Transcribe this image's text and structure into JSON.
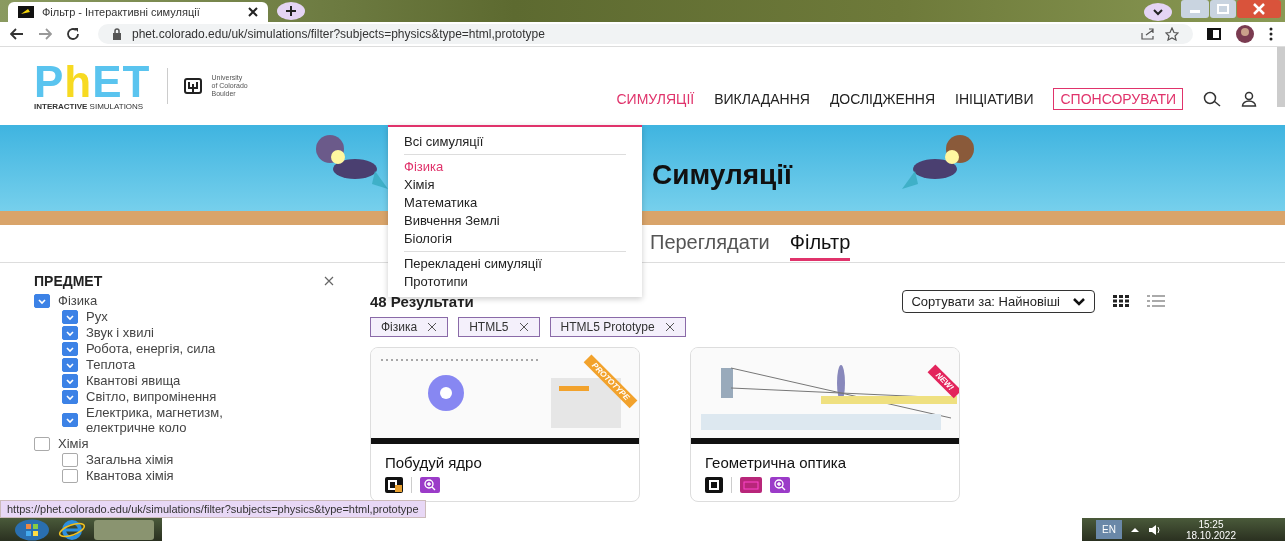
{
  "browser": {
    "tab_title": "Фільтр - Інтерактивні симуляції",
    "url": "phet.colorado.edu/uk/simulations/filter?subjects=physics&type=html,prototype"
  },
  "header": {
    "logo": {
      "wordmark": "PhET",
      "tagline_bold": "INTERACTIVE",
      "tagline": "SIMULATIONS"
    },
    "university": [
      "University",
      "of Colorado",
      "Boulder"
    ],
    "nav": [
      {
        "label": "СИМУЛЯЦІЇ",
        "selected": true
      },
      {
        "label": "ВИКЛАДАННЯ",
        "selected": false
      },
      {
        "label": "ДОСЛІДЖЕННЯ",
        "selected": false
      },
      {
        "label": "ІНІЦІАТИВИ",
        "selected": false
      }
    ],
    "sponsor": "СПОНСОРУВАТИ"
  },
  "banner": {
    "title": "Симуляції"
  },
  "view_tabs": [
    {
      "label": "Переглядати",
      "selected": false
    },
    {
      "label": "Фільтр",
      "selected": true
    }
  ],
  "menu": {
    "groups": [
      [
        {
          "label": "Всі симуляції",
          "selected": false
        }
      ],
      [
        {
          "label": "Фізика",
          "selected": true
        },
        {
          "label": "Хімія",
          "selected": false
        },
        {
          "label": "Математика",
          "selected": false
        },
        {
          "label": "Вивчення Землі",
          "selected": false
        },
        {
          "label": "Біологія",
          "selected": false
        }
      ],
      [
        {
          "label": "Перекладені симуляції",
          "selected": false
        },
        {
          "label": "Прототипи",
          "selected": false
        }
      ]
    ]
  },
  "filters": {
    "heading": "ПРЕДМЕТ",
    "subjects": [
      {
        "label": "Фізика",
        "checked": true,
        "children": [
          {
            "label": "Рух",
            "checked": true
          },
          {
            "label": "Звук і хвилі",
            "checked": true
          },
          {
            "label": "Робота, енергія, сила",
            "checked": true
          },
          {
            "label": "Теплота",
            "checked": true
          },
          {
            "label": "Квантові явища",
            "checked": true
          },
          {
            "label": "Світло, випромінення",
            "checked": true
          },
          {
            "label": "Електрика, магнетизм, електричне коло",
            "checked": true
          }
        ]
      },
      {
        "label": "Хімія",
        "checked": false,
        "children": [
          {
            "label": "Загальна хімія",
            "checked": false
          },
          {
            "label": "Квантова хімія",
            "checked": false
          }
        ]
      }
    ]
  },
  "results": {
    "count": "48 Результати",
    "sort": "Сортувати за: Найновіші",
    "layouts": [
      {
        "kind": "grid",
        "selected": true
      },
      {
        "kind": "list",
        "selected": false
      }
    ],
    "chips": [
      "Фізика",
      "HTML5",
      "HTML5 Prototype"
    ],
    "cards": [
      {
        "title": "Побудуй ядро",
        "ribbon": "PROTOTYPE",
        "color": "#f2a22c",
        "badges": [
          {
            "kind": "html5-prototype"
          },
          {
            "kind": "zoom"
          }
        ]
      },
      {
        "title": "Геометрична оптика",
        "ribbon": "NEW!",
        "color": "#e3245c",
        "badges": [
          {
            "kind": "html5"
          },
          {
            "kind": "keyboard"
          },
          {
            "kind": "zoom"
          }
        ]
      }
    ]
  },
  "status_url": "https://phet.colorado.edu/uk/simulations/filter?subjects=physics&type=html,prototype",
  "taskbar": {
    "language": "EN",
    "time": "15:25",
    "date": "18.10.2022"
  }
}
